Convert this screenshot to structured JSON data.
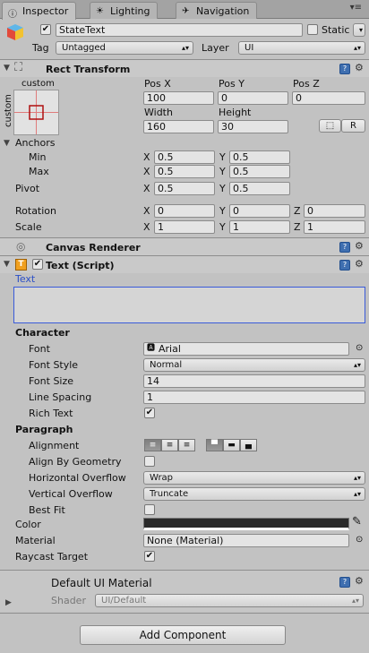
{
  "tabs": [
    {
      "label": "Inspector",
      "icon": "info-icon"
    },
    {
      "label": "Lighting",
      "icon": "lighting-icon"
    },
    {
      "label": "Navigation",
      "icon": "navigation-icon"
    }
  ],
  "object": {
    "name": "StateText",
    "active": true,
    "static_label": "Static",
    "tag_label": "Tag",
    "tag_value": "Untagged",
    "layer_label": "Layer",
    "layer_value": "UI"
  },
  "rect_transform": {
    "title": "Rect Transform",
    "anchor_preset_label": "custom",
    "anchor_side_label": "custom",
    "pos_x_label": "Pos X",
    "pos_y_label": "Pos Y",
    "pos_z_label": "Pos Z",
    "pos_x": "100",
    "pos_y": "0",
    "pos_z": "0",
    "width_label": "Width",
    "height_label": "Height",
    "width": "160",
    "height": "30",
    "raw_button": "R",
    "anchors_label": "Anchors",
    "min_label": "Min",
    "max_label": "Max",
    "min_x": "0.5",
    "min_y": "0.5",
    "max_x": "0.5",
    "max_y": "0.5",
    "pivot_label": "Pivot",
    "pivot_x": "0.5",
    "pivot_y": "0.5",
    "rotation_label": "Rotation",
    "rot_x": "0",
    "rot_y": "0",
    "rot_z": "0",
    "scale_label": "Scale",
    "scale_x": "1",
    "scale_y": "1",
    "scale_z": "1",
    "axis_x": "X",
    "axis_y": "Y",
    "axis_z": "Z"
  },
  "canvas_renderer": {
    "title": "Canvas Renderer"
  },
  "text_script": {
    "title": "Text (Script)",
    "enabled": true,
    "text_label": "Text",
    "text_value": "",
    "character_label": "Character",
    "font_label": "Font",
    "font_value": "Arial",
    "font_style_label": "Font Style",
    "font_style_value": "Normal",
    "font_size_label": "Font Size",
    "font_size_value": "14",
    "line_spacing_label": "Line Spacing",
    "line_spacing_value": "1",
    "rich_text_label": "Rich Text",
    "rich_text": true,
    "paragraph_label": "Paragraph",
    "alignment_label": "Alignment",
    "align_by_geometry_label": "Align By Geometry",
    "align_by_geometry": false,
    "horizontal_overflow_label": "Horizontal Overflow",
    "horizontal_overflow_value": "Wrap",
    "vertical_overflow_label": "Vertical Overflow",
    "vertical_overflow_value": "Truncate",
    "best_fit_label": "Best Fit",
    "best_fit": false,
    "color_label": "Color",
    "color_value": "#2a2a2a",
    "material_label": "Material",
    "material_value": "None (Material)",
    "raycast_label": "Raycast Target",
    "raycast": true
  },
  "material_section": {
    "title": "Default UI Material",
    "shader_label": "Shader",
    "shader_value": "UI/Default"
  },
  "add_component_label": "Add Component",
  "check_glyph": "✔",
  "colors": {
    "panel": "#c2c2c2",
    "text_field_focus": "#3a5bd9",
    "help_icon": "#3f6fb0"
  }
}
